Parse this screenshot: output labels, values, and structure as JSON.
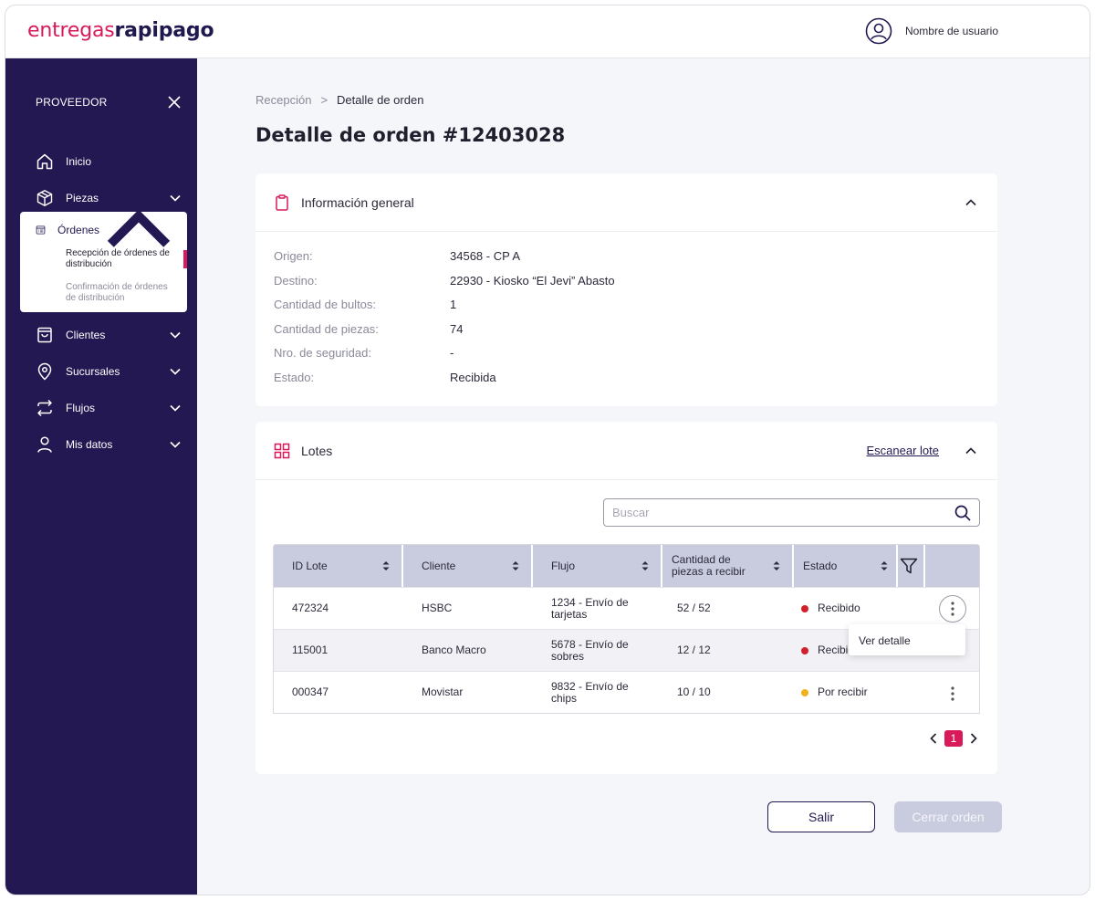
{
  "header": {
    "logo_part1": "entregas",
    "logo_part2": "rapipago",
    "user_name": "Nombre de usuario"
  },
  "sidebar": {
    "title": "PROVEEDOR",
    "items": [
      {
        "label": "Inicio",
        "icon": "home-icon"
      },
      {
        "label": "Piezas",
        "icon": "box-icon"
      },
      {
        "label": "Órdenes",
        "icon": "list-icon",
        "expanded": true,
        "subitems": [
          {
            "label": "Recepción de órdenes de distribución",
            "active": true
          },
          {
            "label": "Confirmación de órdenes de distribución",
            "active": false
          }
        ]
      },
      {
        "label": "Clientes",
        "icon": "bag-icon"
      },
      {
        "label": "Sucursales",
        "icon": "location-pin-icon"
      },
      {
        "label": "Flujos",
        "icon": "swap-icon"
      },
      {
        "label": "Mis datos",
        "icon": "user-icon"
      }
    ]
  },
  "breadcrumb": {
    "parent": "Recepción",
    "separator": ">",
    "current": "Detalle de orden"
  },
  "page_title": "Detalle de orden #12403028",
  "general_info": {
    "title": "Información general",
    "rows": [
      {
        "label": "Origen:",
        "value": "34568 - CP A"
      },
      {
        "label": "Destino:",
        "value": "22930 - Kiosko “El Jevi” Abasto"
      },
      {
        "label": "Cantidad de bultos:",
        "value": "1"
      },
      {
        "label": "Cantidad de piezas:",
        "value": "74"
      },
      {
        "label": "Nro. de seguridad:",
        "value": "-"
      },
      {
        "label": "Estado:",
        "value": "Recibida"
      }
    ]
  },
  "lots": {
    "title": "Lotes",
    "scan_link": "Escanear lote",
    "search_placeholder": "Buscar",
    "columns": [
      "ID Lote",
      "Cliente",
      "Flujo",
      "Cantidad de piezas a recibir",
      "Estado"
    ],
    "rows": [
      {
        "id": "472324",
        "client": "HSBC",
        "flow": "1234 - Envío de tarjetas",
        "qty": "52 / 52",
        "status": "Recibido",
        "status_color": "#d0202a"
      },
      {
        "id": "115001",
        "client": "Banco Macro",
        "flow": "5678 - Envío de sobres",
        "qty": "12 / 12",
        "status": "Recibido",
        "status_color": "#d0202a"
      },
      {
        "id": "000347",
        "client": "Movistar",
        "flow": "9832 - Envío de chips",
        "qty": "10 / 10",
        "status": "Por recibir",
        "status_color": "#f2b01e"
      }
    ],
    "context_menu_item": "Ver detalle",
    "current_page": "1"
  },
  "actions": {
    "exit_label": "Salir",
    "close_label": "Cerrar orden"
  },
  "colors": {
    "brand_primary": "#231851",
    "brand_accent": "#d8195a",
    "table_header_bg": "#c9cbdf"
  }
}
